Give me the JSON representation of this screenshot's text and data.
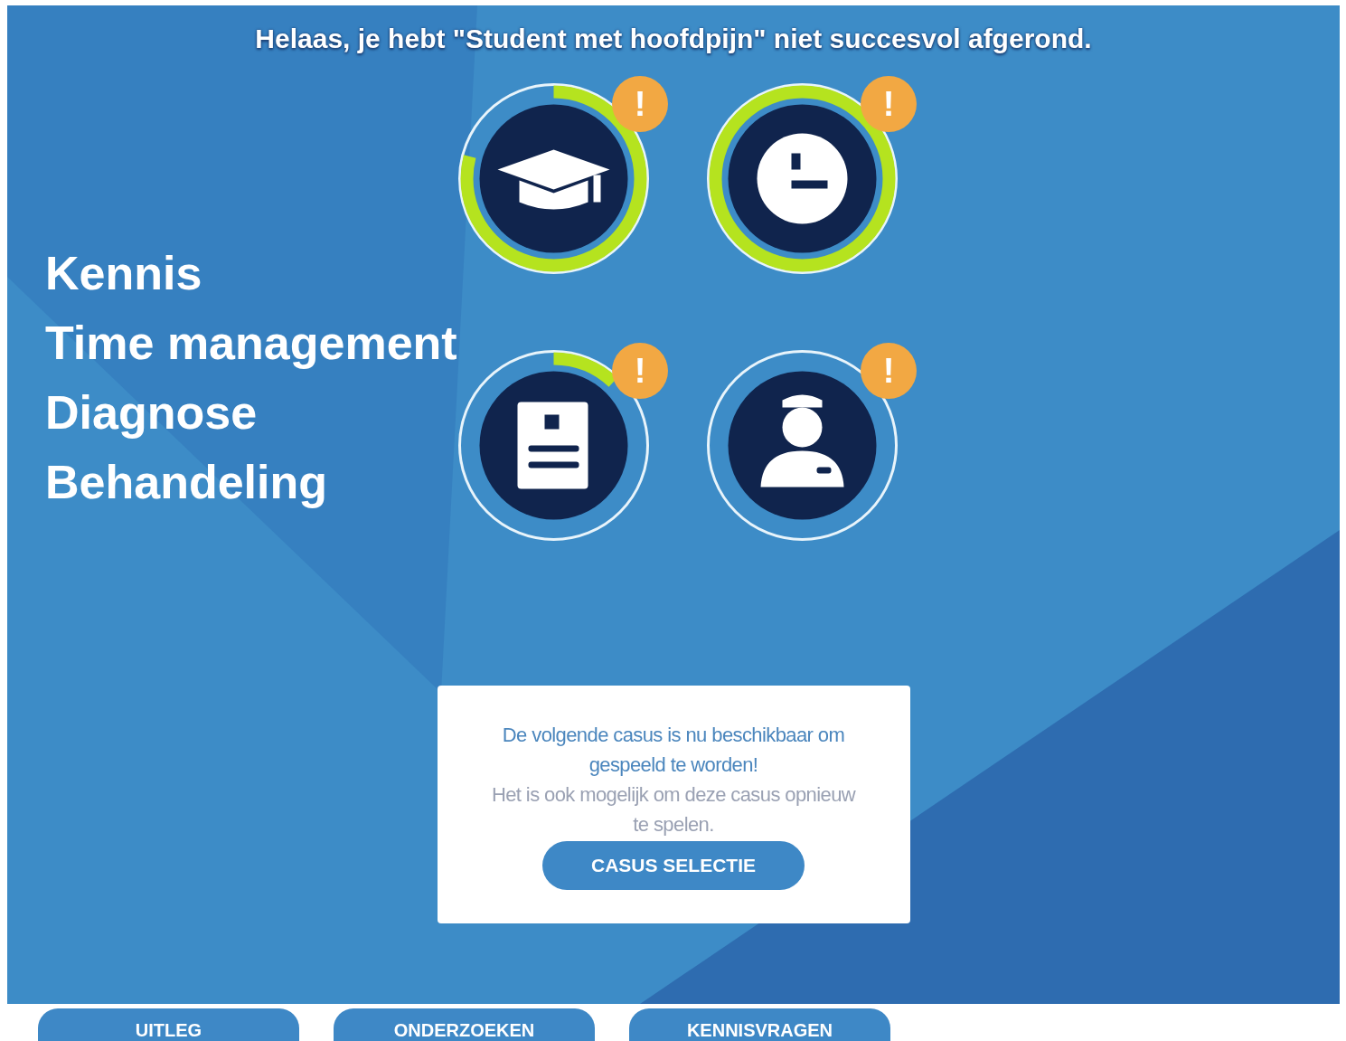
{
  "header": {
    "title": "Helaas, je hebt \"Student met hoofdpijn\" niet succesvol afgerond."
  },
  "scores": [
    {
      "kind": "knowledge",
      "alert": "!"
    },
    {
      "kind": "time",
      "alert": "!"
    },
    {
      "kind": "diagnosis",
      "alert": "!"
    },
    {
      "kind": "treatment",
      "alert": "!"
    }
  ],
  "legend": [
    "Kennis",
    "Time management",
    "Diagnose",
    "Behandeling"
  ],
  "dialog": {
    "message": "De volgende casus is nu beschikbaar om gespeeld te worden!",
    "note": "Het is ook mogelijk om deze casus opnieuw te spelen.",
    "button": "CASUS SELECTIE"
  },
  "tabs": [
    {
      "label": "UITLEG"
    },
    {
      "label": "ONDERZOEKEN"
    },
    {
      "label": "KENNISVRAGEN"
    }
  ]
}
